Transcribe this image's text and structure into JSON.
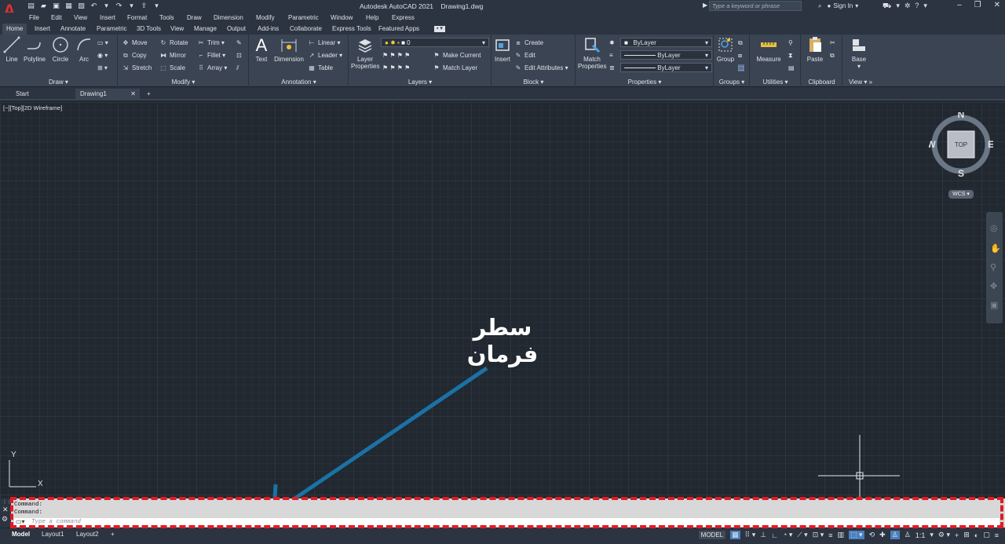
{
  "title_bar": {
    "app_title": "Autodesk AutoCAD 2021",
    "document_title": "Drawing1.dwg",
    "search_placeholder": "Type a keyword or phrase",
    "sign_in": "Sign In",
    "logo": "A"
  },
  "menu": [
    "File",
    "Edit",
    "View",
    "Insert",
    "Format",
    "Tools",
    "Draw",
    "Dimension",
    "Modify",
    "Parametric",
    "Window",
    "Help",
    "Express"
  ],
  "ribbon_tabs": [
    "Home",
    "Insert",
    "Annotate",
    "Parametric",
    "3D Tools",
    "View",
    "Manage",
    "Output",
    "Add-ins",
    "Collaborate",
    "Express Tools",
    "Featured Apps"
  ],
  "panels": {
    "draw": {
      "label": "Draw",
      "tools": [
        "Line",
        "Polyline",
        "Circle",
        "Arc"
      ]
    },
    "modify": {
      "label": "Modify",
      "tools": [
        "Move",
        "Rotate",
        "Trim",
        "Copy",
        "Mirror",
        "Fillet",
        "Stretch",
        "Scale",
        "Array"
      ]
    },
    "annotation": {
      "label": "Annotation",
      "tools": [
        "Text",
        "Dimension",
        "Linear",
        "Leader",
        "Table"
      ]
    },
    "layers": {
      "label": "Layers",
      "layer_properties_1": "Layer",
      "layer_properties_2": "Properties",
      "current_layer": "0",
      "make_current": "Make Current",
      "match_layer": "Match Layer"
    },
    "block": {
      "label": "Block",
      "insert": "Insert",
      "create": "Create",
      "edit": "Edit",
      "edit_attributes": "Edit Attributes"
    },
    "properties": {
      "label": "Properties",
      "match_1": "Match",
      "match_2": "Properties",
      "color": "ByLayer",
      "linetype": "ByLayer",
      "lineweight": "ByLayer"
    },
    "groups": {
      "label": "Groups",
      "group": "Group"
    },
    "utilities": {
      "label": "Utilities",
      "measure": "Measure"
    },
    "clipboard": {
      "label": "Clipboard",
      "paste": "Paste"
    },
    "view": {
      "label": "View",
      "base": "Base"
    }
  },
  "doc_tabs": [
    "Start",
    "Drawing1"
  ],
  "viewport": {
    "label": "[−][Top][2D Wireframe]",
    "compass": {
      "n": "N",
      "s": "S",
      "e": "E",
      "w": "W",
      "top": "TOP"
    },
    "wcs": "WCS",
    "ucs_x": "X",
    "ucs_y": "Y",
    "annotation_text": "سطر فرمان"
  },
  "command_line": {
    "history": [
      "Command:",
      "Command:"
    ],
    "placeholder": "Type a command"
  },
  "status": {
    "layout_tabs": [
      "Model",
      "Layout1",
      "Layout2"
    ],
    "model_button": "MODEL",
    "scale": "1:1"
  },
  "colors": {
    "accent": "#e01b24",
    "arrow": "#1a72a6",
    "background": "#212830"
  }
}
